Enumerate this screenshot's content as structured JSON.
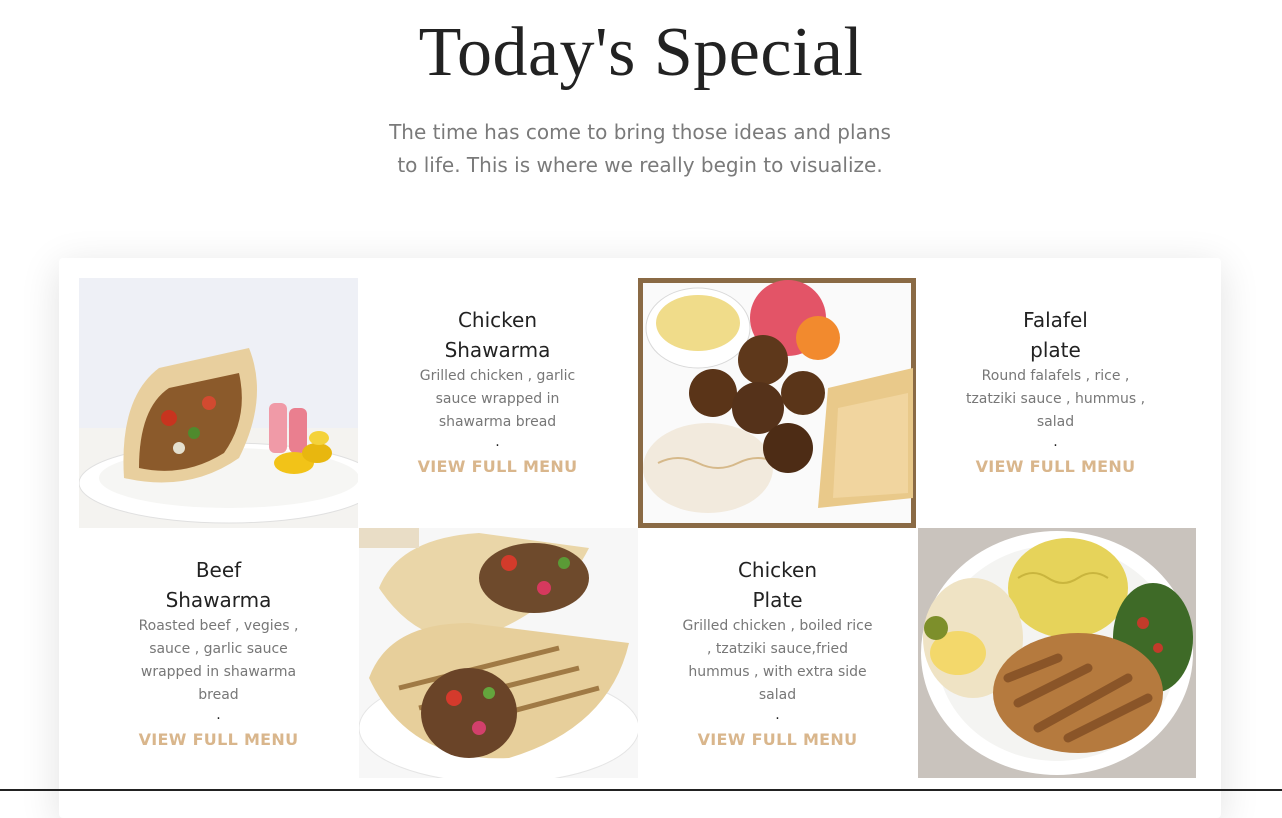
{
  "header": {
    "title": "Today's Special",
    "subtitle": "The time has come to bring those ideas and plans to life. This is where we really begin to visualize."
  },
  "menu": {
    "items": [
      {
        "name_line1": "Chicken",
        "name_line2": "Shawarma",
        "description": "Grilled chicken , garlic sauce wrapped in shawarma bread",
        "dot": ".",
        "link": "View Full Menu"
      },
      {
        "name_line1": "Falafel",
        "name_line2": "plate",
        "description": "Round falafels , rice , tzatziki sauce , hummus , salad",
        "dot": ".",
        "link": "View Full Menu"
      },
      {
        "name_line1": "Beef",
        "name_line2": "Shawarma",
        "description": "Roasted beef , vegies , sauce , garlic sauce wrapped in shawarma bread",
        "dot": ".",
        "link": "View Full Menu"
      },
      {
        "name_line1": "Chicken",
        "name_line2": "Plate",
        "description": "Grilled chicken , boiled rice , tzatziki sauce,fried hummus , with extra side salad",
        "dot": ".",
        "link": "View Full Menu"
      }
    ]
  },
  "colors": {
    "accent": "#d9b68c",
    "heading": "#222222",
    "muted": "#777777"
  }
}
